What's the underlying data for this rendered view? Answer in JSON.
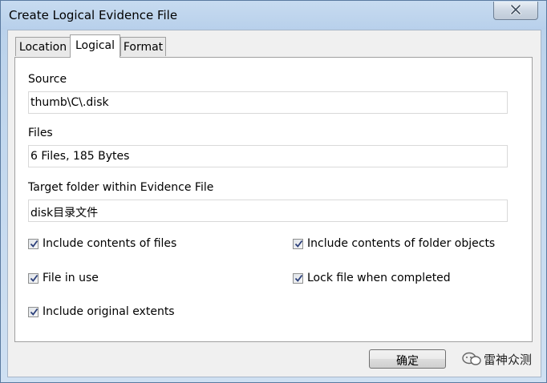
{
  "window": {
    "title": "Create Logical Evidence File"
  },
  "tabs": [
    {
      "label": "Location",
      "active": false
    },
    {
      "label": "Logical",
      "active": true
    },
    {
      "label": "Format",
      "active": false
    }
  ],
  "form": {
    "source_label": "Source",
    "source_value": "thumb\\C\\.disk",
    "files_label": "Files",
    "files_value": "6 Files, 185 Bytes",
    "target_label": "Target folder within Evidence File",
    "target_value": "disk目录文件"
  },
  "options": {
    "include_contents_of_files": {
      "label": "Include contents of files",
      "checked": true
    },
    "include_contents_of_folder_objects": {
      "label": "Include contents of folder objects",
      "checked": true
    },
    "file_in_use": {
      "label": "File in use",
      "checked": true
    },
    "lock_file_when_completed": {
      "label": "Lock file when completed",
      "checked": true
    },
    "include_original_extents": {
      "label": "Include original extents",
      "checked": true
    }
  },
  "buttons": {
    "ok_label": "确定"
  },
  "watermark": {
    "text": "雷神众测"
  }
}
